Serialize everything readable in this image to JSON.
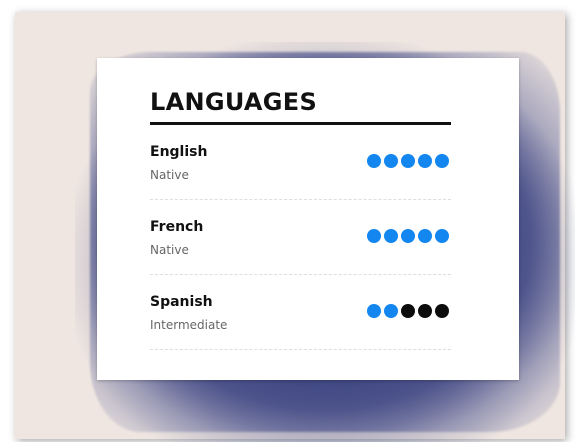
{
  "section": {
    "title": "LANGUAGES",
    "dot_scale": 5,
    "colors": {
      "filled": "#1387ef",
      "empty": "#0c0c0c",
      "accent_bg": "#2a3270",
      "paper": "#efe6e1"
    },
    "languages": [
      {
        "name": "English",
        "level": "Native",
        "rating": 5
      },
      {
        "name": "French",
        "level": "Native",
        "rating": 5
      },
      {
        "name": "Spanish",
        "level": "Intermediate",
        "rating": 2
      }
    ]
  }
}
